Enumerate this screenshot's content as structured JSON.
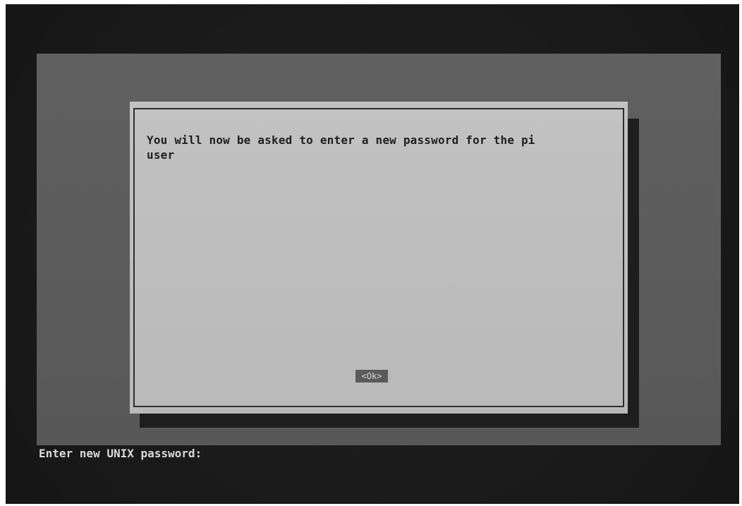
{
  "dialog": {
    "message": "You will now be asked to enter a new password for the pi\nuser",
    "ok_label": "<Ok>"
  },
  "console": {
    "prompt": "Enter new UNIX password:"
  },
  "colors": {
    "screen_background": "#1a1a1a",
    "console_background": "#5c5c5c",
    "dialog_background": "#bdbdbd",
    "dialog_shadow": "#1e1e1e",
    "button_background": "#5a5a5a"
  }
}
